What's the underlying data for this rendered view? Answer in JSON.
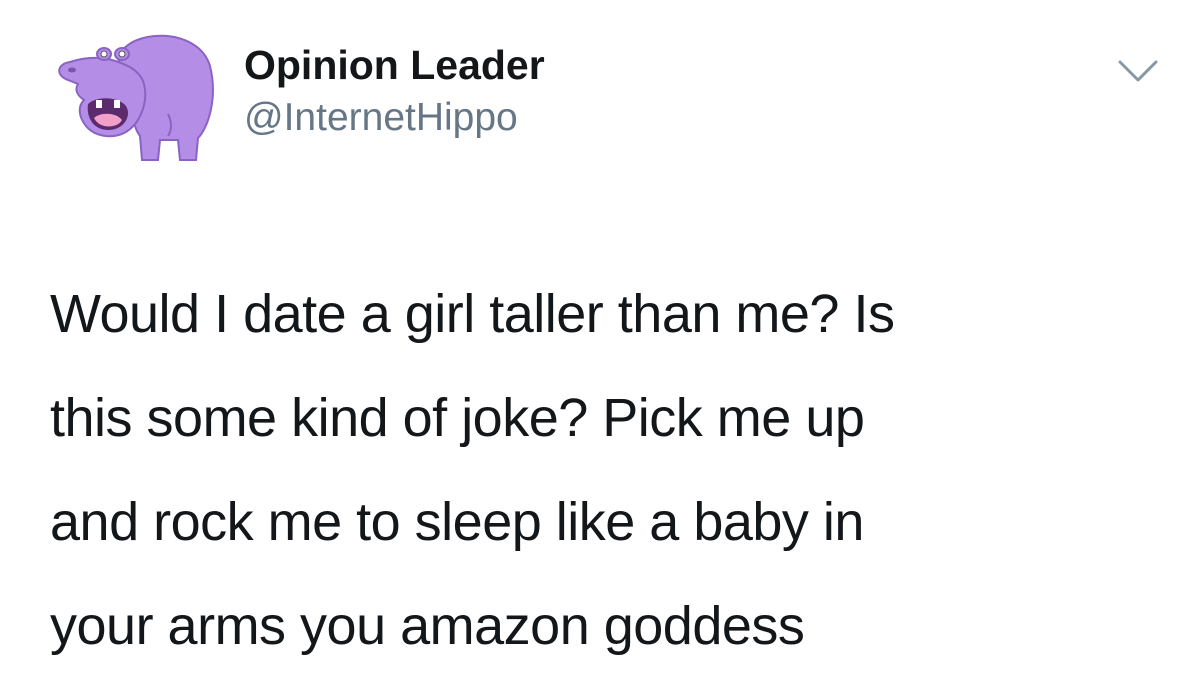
{
  "author": {
    "display_name": "Opinion Leader",
    "handle": "@InternetHippo",
    "avatar_icon": "hippo-avatar-icon",
    "avatar_color": "#b48ee6"
  },
  "menu": {
    "icon": "chevron-down-icon"
  },
  "tweet": {
    "lines": [
      "Would I date a girl taller than me? Is",
      "this some kind of joke? Pick me up",
      "and rock me to sleep like a baby in",
      "your arms you amazon goddess"
    ]
  },
  "colors": {
    "text": "#14171a",
    "handle": "#657786",
    "caret": "#8899a6"
  }
}
